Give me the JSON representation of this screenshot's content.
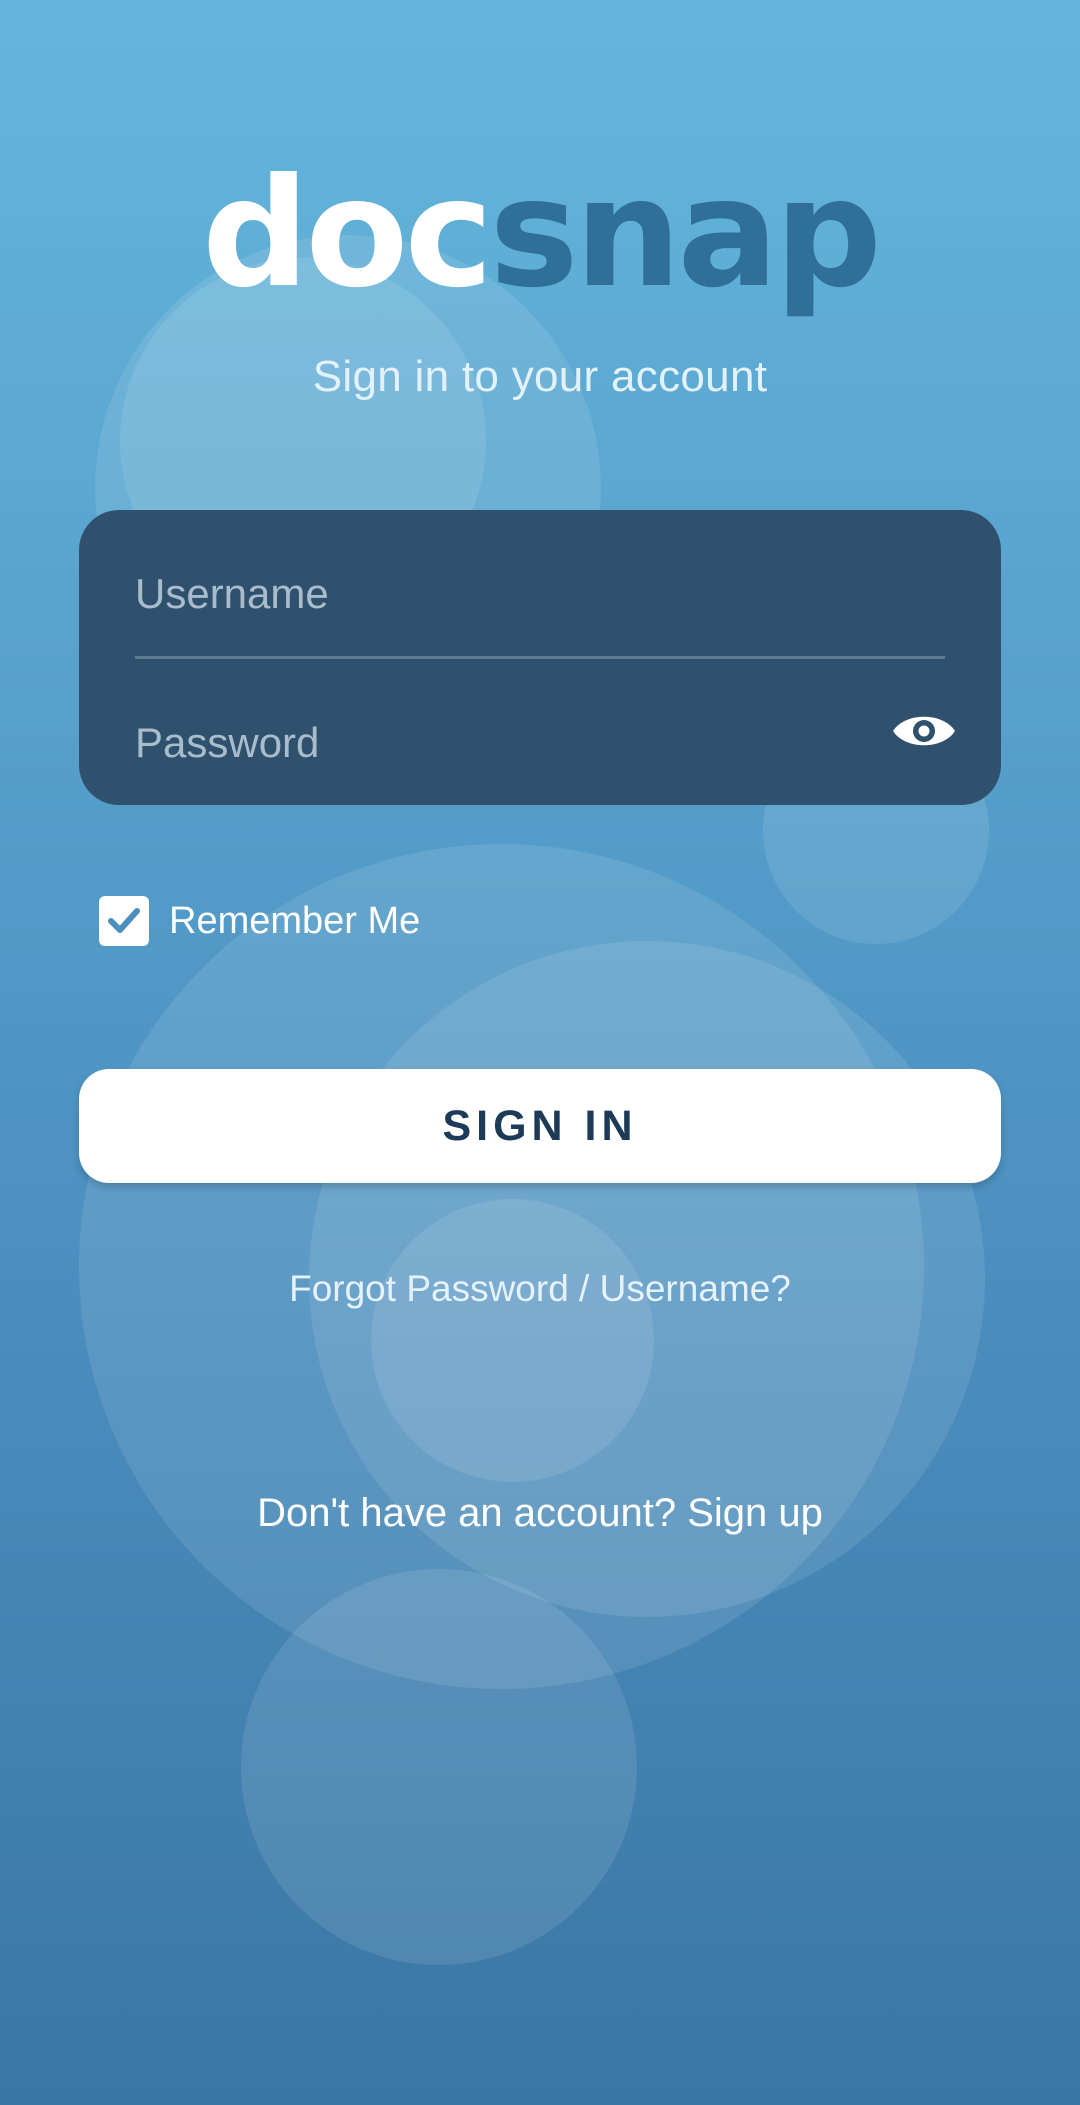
{
  "brand": {
    "logo_part_1": "doc",
    "logo_part_2": "snap",
    "logo_color_light": "#ffffff",
    "logo_color_dark": "#2f6f98"
  },
  "subtitle": "Sign in to your account",
  "form": {
    "username_placeholder": "Username",
    "password_placeholder": "Password",
    "password_toggle_icon": "eye-icon"
  },
  "remember_me": {
    "label": "Remember Me",
    "checked": true
  },
  "signin_button_label": "SIGN IN",
  "forgot_link": "Forgot Password / Username?",
  "signup_link": "Don't have an account? Sign up",
  "colors": {
    "card_background": "#2f516e",
    "button_text": "#1d3a59"
  }
}
